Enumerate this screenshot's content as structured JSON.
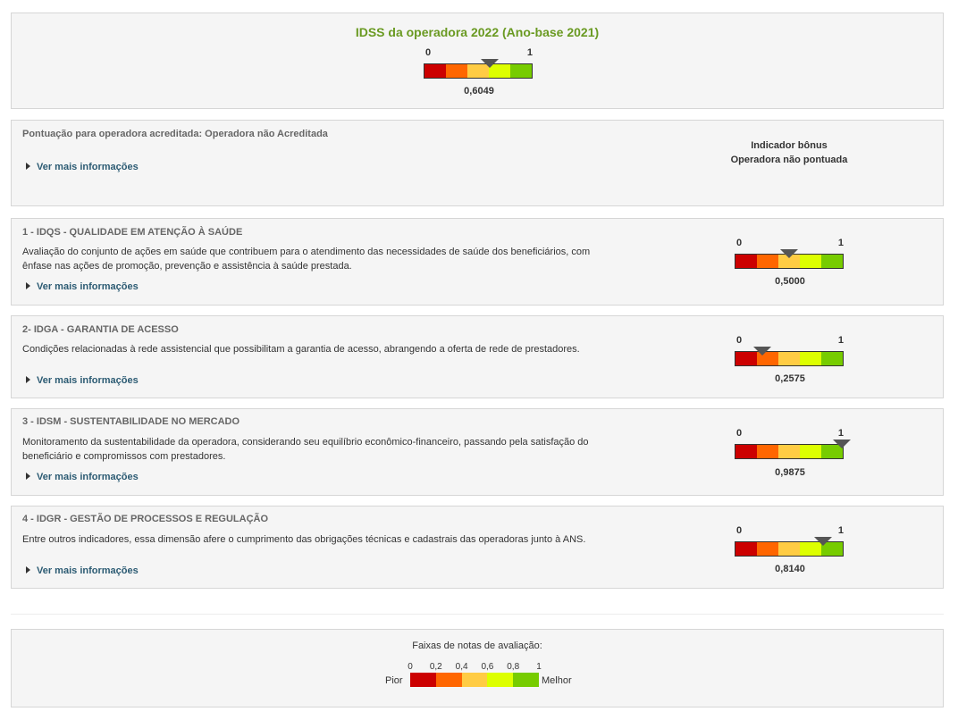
{
  "colors": {
    "band1": "#cc0000",
    "band2": "#ff6600",
    "band3": "#ffcc44",
    "band4": "#ddff00",
    "band5": "#77cc00",
    "title_green": "#6a9a22",
    "link": "#2c5b73",
    "pointer": "#555555"
  },
  "overall": {
    "title": "IDSS da operadora 2022 (Ano-base 2021)",
    "min_label": "0",
    "max_label": "1",
    "value": 0.6049,
    "value_label": "0,6049"
  },
  "accreditation": {
    "text": "Pontuação para operadora acreditada: Operadora não Acreditada",
    "more_link": "Ver mais informações",
    "bonus_title": "Indicador bônus",
    "bonus_status": "Operadora não pontuada"
  },
  "dimensions": [
    {
      "title": "1 - IDQS - QUALIDADE EM ATENÇÃO À SAÚDE",
      "description": "Avaliação do conjunto de ações em saúde que contribuem para o atendimento das necessidades de saúde dos beneficiários, com ênfase nas ações de promoção, prevenção e assistência à saúde prestada.",
      "more_link": "Ver mais informações",
      "min_label": "0",
      "max_label": "1",
      "value": 0.5,
      "value_label": "0,5000"
    },
    {
      "title": "2- IDGA - GARANTIA DE ACESSO",
      "description": "Condições relacionadas à rede assistencial que possibilitam a garantia de acesso, abrangendo a oferta de rede de prestadores.",
      "more_link": "Ver mais informações",
      "min_label": "0",
      "max_label": "1",
      "value": 0.2575,
      "value_label": "0,2575"
    },
    {
      "title": "3 - IDSM - SUSTENTABILIDADE NO MERCADO",
      "description": "Monitoramento da sustentabilidade da operadora, considerando seu equilíbrio econômico-financeiro, passando pela satisfação do beneficiário e compromissos com prestadores.",
      "more_link": "Ver mais informações",
      "min_label": "0",
      "max_label": "1",
      "value": 0.9875,
      "value_label": "0,9875"
    },
    {
      "title": "4 - IDGR - GESTÃO DE PROCESSOS E REGULAÇÃO",
      "description": "Entre outros indicadores, essa dimensão afere o cumprimento das obrigações técnicas e cadastrais das operadoras junto à ANS.",
      "more_link": "Ver mais informações",
      "min_label": "0",
      "max_label": "1",
      "value": 0.814,
      "value_label": "0,8140"
    }
  ],
  "legend": {
    "title": "Faixas de notas de avaliação:",
    "ticks": [
      "0",
      "0,2",
      "0,4",
      "0,6",
      "0,8",
      "1"
    ],
    "worst_label": "Pior",
    "best_label": "Melhor"
  }
}
